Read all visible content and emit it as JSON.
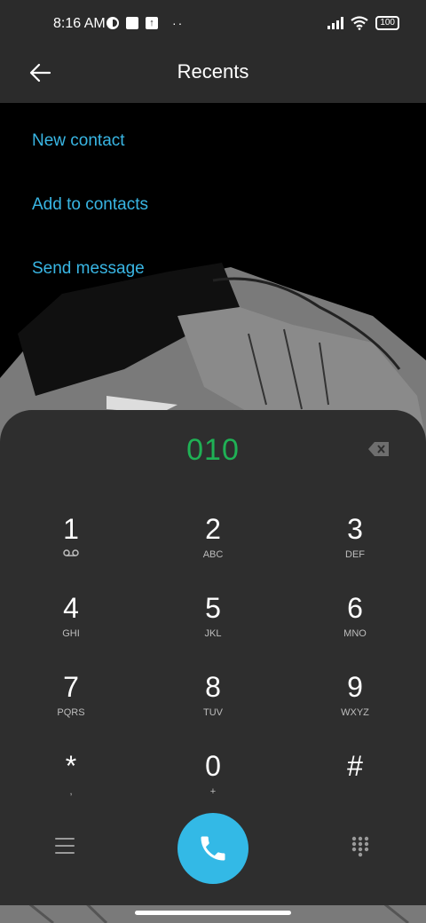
{
  "status_bar": {
    "time": "8:16 AM",
    "battery": "100"
  },
  "header": {
    "title": "Recents"
  },
  "actions": {
    "new_contact": "New contact",
    "add_to_contacts": "Add to contacts",
    "send_message": "Send message"
  },
  "dialpad": {
    "number": "010",
    "keys": [
      {
        "digit": "1",
        "letters": ""
      },
      {
        "digit": "2",
        "letters": "ABC"
      },
      {
        "digit": "3",
        "letters": "DEF"
      },
      {
        "digit": "4",
        "letters": "GHI"
      },
      {
        "digit": "5",
        "letters": "JKL"
      },
      {
        "digit": "6",
        "letters": "MNO"
      },
      {
        "digit": "7",
        "letters": "PQRS"
      },
      {
        "digit": "8",
        "letters": "TUV"
      },
      {
        "digit": "9",
        "letters": "WXYZ"
      },
      {
        "digit": "*",
        "letters": ","
      },
      {
        "digit": "0",
        "letters": "+"
      },
      {
        "digit": "#",
        "letters": ""
      }
    ]
  },
  "colors": {
    "accent_blue": "#39b6e4",
    "number_green": "#1fb155",
    "call_button": "#33b9e6"
  }
}
